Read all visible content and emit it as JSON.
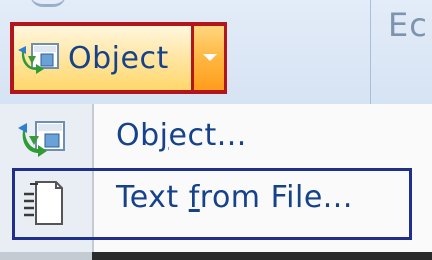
{
  "ribbon": {
    "next_group_label": "Ec"
  },
  "split_button": {
    "label": "Object",
    "icon": "object-icon",
    "dropdown_icon": "chevron-down-icon",
    "highlight_color": "#b0161c"
  },
  "menu": {
    "items": [
      {
        "label_pre": "Ob",
        "label_accel": "j",
        "label_post": "ect...",
        "icon": "object-icon"
      },
      {
        "label_pre": "Text ",
        "label_accel": "f",
        "label_post": "rom File...",
        "icon": "text-file-icon",
        "focus_color": "#1f2f8a"
      }
    ]
  }
}
